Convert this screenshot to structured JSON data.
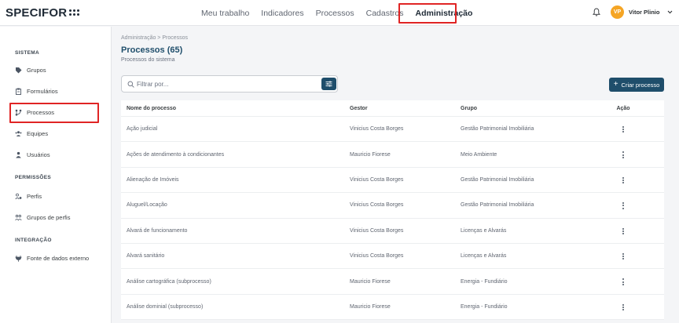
{
  "app": {
    "logo_text": "SPECIFOR"
  },
  "topnav": {
    "items": [
      {
        "label": "Meu trabalho"
      },
      {
        "label": "Indicadores"
      },
      {
        "label": "Processos"
      },
      {
        "label": "Cadastros"
      },
      {
        "label": "Administração"
      }
    ],
    "active": "Administração"
  },
  "user": {
    "initials": "VP",
    "name": "Vitor Plinio",
    "avatar_color": "#f5a524"
  },
  "sidebar": {
    "sections": [
      {
        "title": "SISTEMA",
        "items": [
          {
            "label": "Grupos",
            "icon": "tag-icon"
          },
          {
            "label": "Formulários",
            "icon": "clipboard-icon"
          },
          {
            "label": "Processos",
            "icon": "process-icon"
          },
          {
            "label": "Equipes",
            "icon": "team-icon"
          },
          {
            "label": "Usuários",
            "icon": "user-icon"
          }
        ]
      },
      {
        "title": "PERMISSÕES",
        "items": [
          {
            "label": "Perfis",
            "icon": "profile-icon"
          },
          {
            "label": "Grupos de perfis",
            "icon": "profile-group-icon"
          }
        ]
      },
      {
        "title": "INTEGRAÇÃO",
        "items": [
          {
            "label": "Fonte de dados externo",
            "icon": "plug-icon"
          }
        ]
      }
    ],
    "selected": "Processos"
  },
  "page": {
    "breadcrumb": "Administração  >  Processos",
    "title": "Processos (65)",
    "subtitle": "Processos do sistema"
  },
  "search": {
    "placeholder": "Filtrar por...",
    "value": ""
  },
  "actions": {
    "create_label": "Criar processo"
  },
  "table": {
    "headers": [
      "Nome do processo",
      "Gestor",
      "Grupo",
      "Ação"
    ],
    "rows": [
      [
        "Ação judicial",
        "Vinicius Costa Borges",
        "Gestão Patrimonial Imobiliária"
      ],
      [
        "Ações de atendimento à condicionantes",
        "Mauricio Fiorese",
        "Meio Ambiente"
      ],
      [
        "Alienação de Imóveis",
        "Vinicius Costa Borges",
        "Gestão Patrimonial Imobiliária"
      ],
      [
        "Aluguel/Locação",
        "Vinicius Costa Borges",
        "Gestão Patrimonial Imobiliária"
      ],
      [
        "Alvará de funcionamento",
        "Vinicius Costa Borges",
        "Licenças e Alvarás"
      ],
      [
        "Alvará sanitário",
        "Vinicius Costa Borges",
        "Licenças e Alvarás"
      ],
      [
        "Análise cartográfica (subprocesso)",
        "Mauricio Fiorese",
        "Energia - Fundiário"
      ],
      [
        "Análise dominial (subprocesso)",
        "Mauricio Fiorese",
        "Energia - Fundiário"
      ]
    ]
  },
  "colors": {
    "primary": "#1f4e6b",
    "highlight": "#e02424"
  }
}
